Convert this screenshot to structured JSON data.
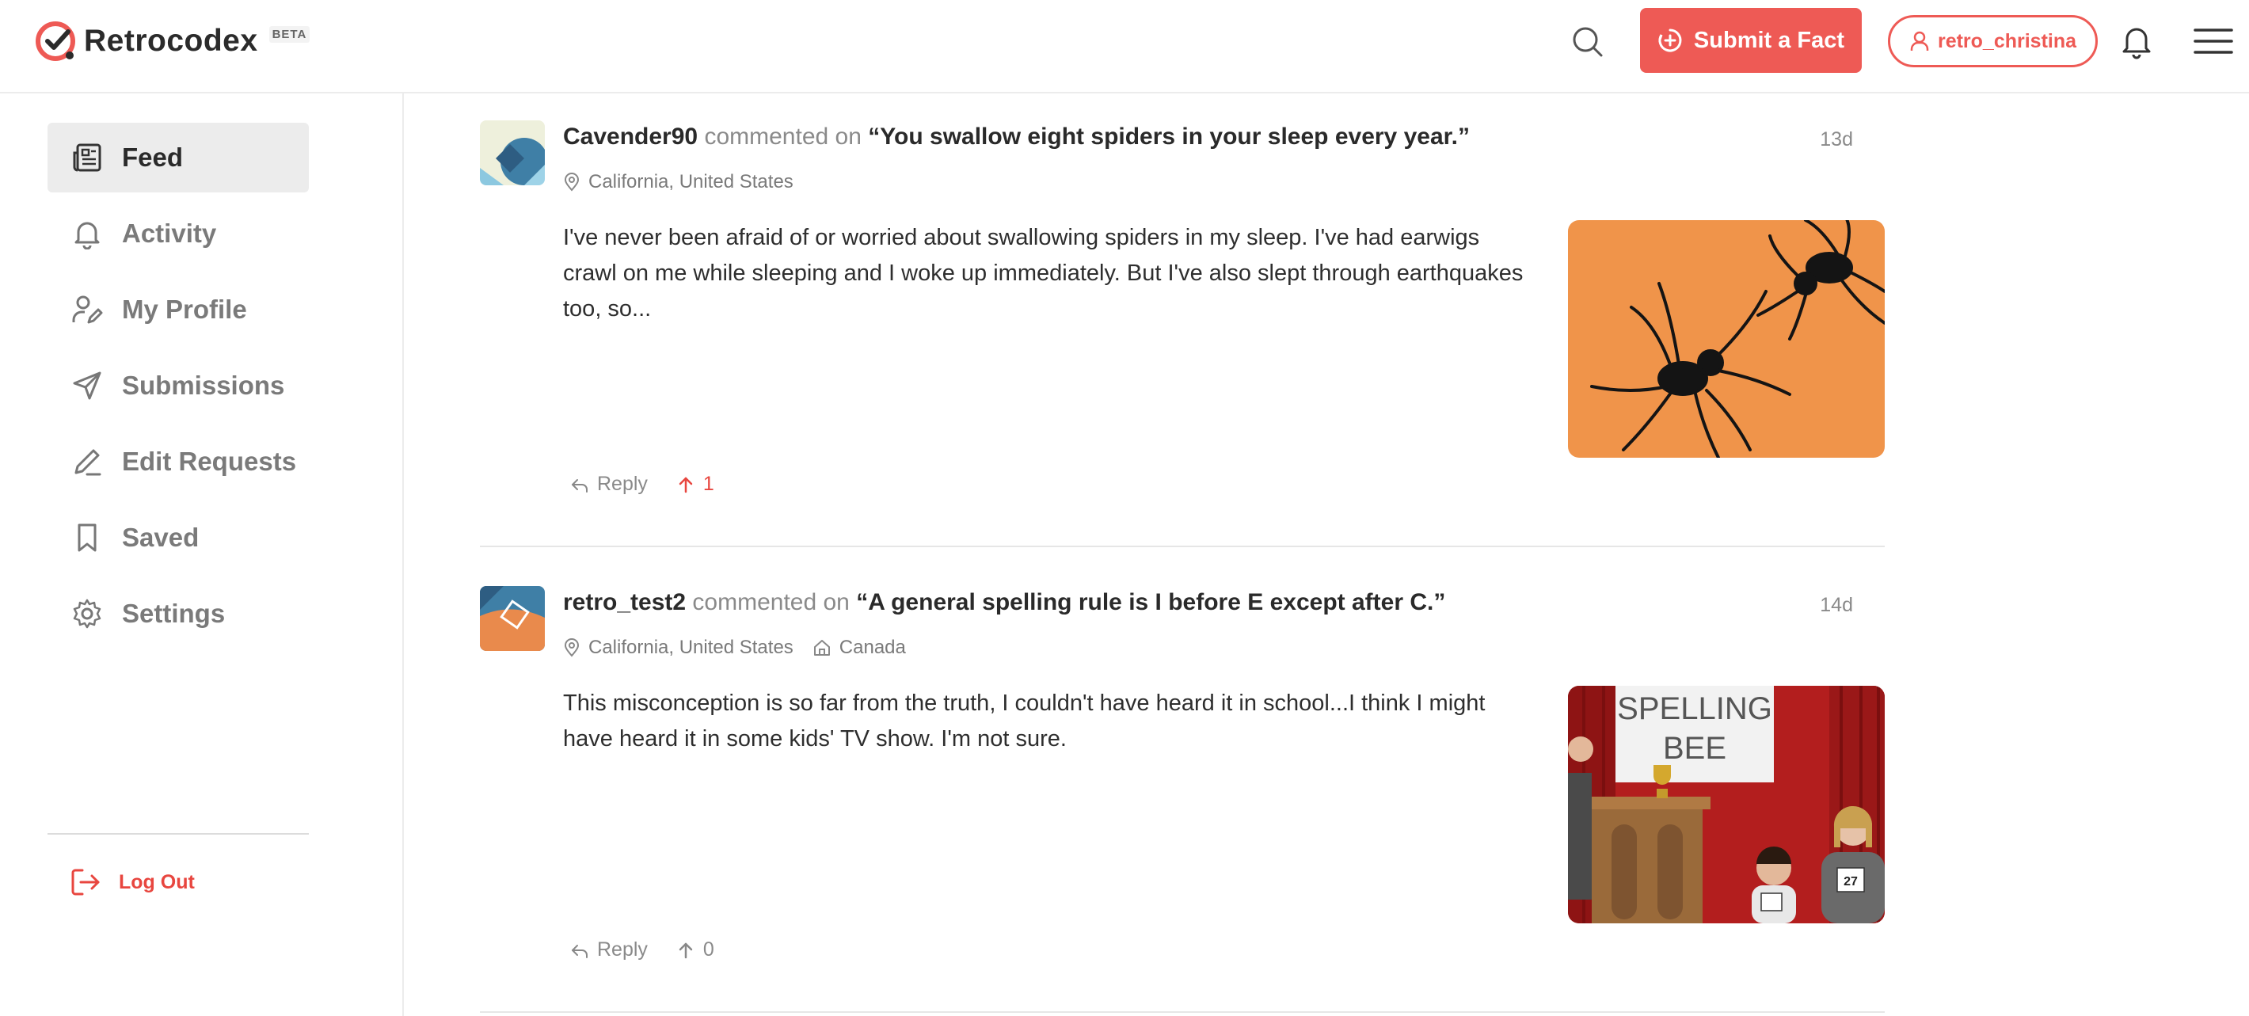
{
  "header": {
    "logo_text": "Retrocodex",
    "beta_label": "BETA",
    "submit_label": "Submit a Fact",
    "username": "retro_christina"
  },
  "colors": {
    "accent": "#ee5a55",
    "active_nav_bg": "#ececec"
  },
  "sidebar": {
    "items": [
      {
        "label": "Feed",
        "icon": "newspaper-icon",
        "active": true
      },
      {
        "label": "Activity",
        "icon": "bell-icon"
      },
      {
        "label": "My Profile",
        "icon": "user-edit-icon"
      },
      {
        "label": "Submissions",
        "icon": "send-icon"
      },
      {
        "label": "Edit Requests",
        "icon": "pencil-icon"
      },
      {
        "label": "Saved",
        "icon": "bookmark-icon"
      },
      {
        "label": "Settings",
        "icon": "gear-icon"
      }
    ],
    "logout_label": "Log Out"
  },
  "feed": [
    {
      "username": "Cavender90",
      "action": "commented on",
      "fact": "“You swallow eight spiders in your sleep every year.”",
      "time": "13d",
      "location": "California, United States",
      "body": "I've never been afraid of or worried about swallowing spiders in my sleep. I've had earwigs crawl on me while sleeping and I woke up immediately. But I've also slept through earthquakes too, so...",
      "reply_label": "Reply",
      "upvotes": "1",
      "thumbnail": "spiders-image"
    },
    {
      "username": "retro_test2",
      "action": "commented on",
      "fact": "“A general spelling rule is I before E except after C.”",
      "time": "14d",
      "location": "California, United States",
      "secondary_location": "Canada",
      "body": "This misconception is so far from the truth, I couldn't have heard it in school...I think I might have heard it in some kids' TV show. I'm not sure.",
      "reply_label": "Reply",
      "upvotes": "0",
      "thumbnail": "spelling-bee-image",
      "thumbnail_sign": [
        "SPELLING",
        "BEE"
      ],
      "thumbnail_badge": "27"
    }
  ]
}
